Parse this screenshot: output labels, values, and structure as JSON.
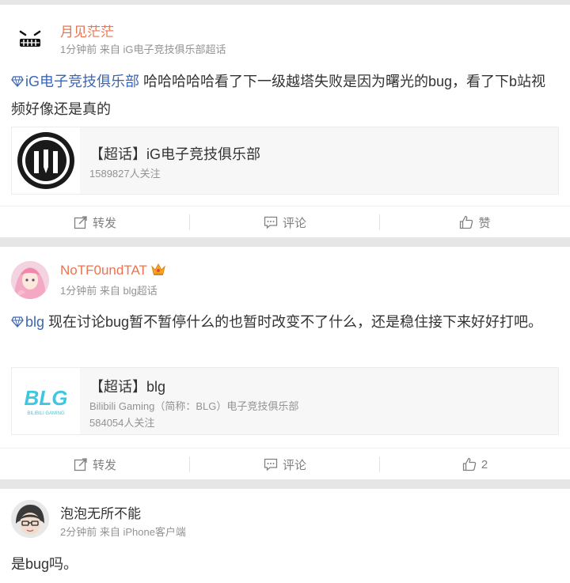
{
  "posts": [
    {
      "author": "月见茫茫",
      "meta": "1分钟前 来自 iG电子竞技俱乐部超话",
      "topic": "iG电子竞技俱乐部",
      "text": " 哈哈哈哈哈看了下一级越塔失败是因为曙光的bug，看了下b站视频好像还是真的",
      "embed_title": "【超话】iG电子竞技俱乐部",
      "embed_sub1": "1589827人关注",
      "embed_sub2": ""
    },
    {
      "author": "NoTF0undTAT",
      "meta": "1分钟前 来自 blg超话",
      "topic": "blg",
      "text": " 现在讨论bug暂不暂停什么的也暂时改变不了什么，还是稳住接下来好好打吧。",
      "embed_title": "【超话】blg",
      "embed_sub1": "Bilibili Gaming（简称：BLG）电子竞技俱乐部",
      "embed_sub2": "584054人关注",
      "embed_logo_text": "BLG",
      "embed_logo_sub": "BILIBILI GAMING"
    },
    {
      "author": "泡泡无所不能",
      "meta": "2分钟前 来自 iPhone客户端",
      "text": "是bug吗。"
    }
  ],
  "actions": {
    "repost": "转发",
    "comment": "评论",
    "like": "赞",
    "like_count_2": "2"
  },
  "colors": {
    "name_orange": "#eb7350",
    "topic_blue": "#3a67b8",
    "meta_gray": "#939393",
    "separator": "#e6e6e6"
  }
}
